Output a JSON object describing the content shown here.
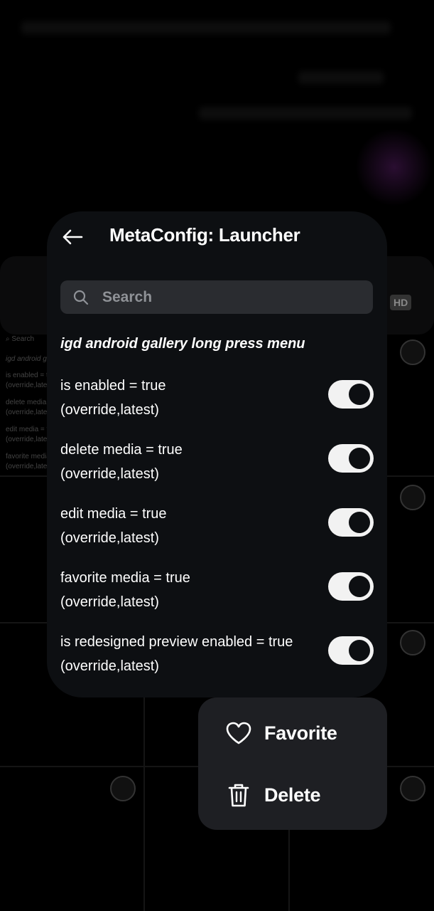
{
  "dialog": {
    "title": "MetaConfig: Launcher",
    "back_icon": "arrow-left-icon",
    "search": {
      "placeholder": "Search",
      "value": ""
    },
    "section_title": "igd android gallery long press menu",
    "configs": [
      {
        "line1": "is enabled = true",
        "line2": "(override,latest)",
        "enabled": true
      },
      {
        "line1": "delete media = true",
        "line2": "(override,latest)",
        "enabled": true
      },
      {
        "line1": "edit media = true",
        "line2": "(override,latest)",
        "enabled": true
      },
      {
        "line1": "favorite media = true",
        "line2": "(override,latest)",
        "enabled": true
      },
      {
        "line1": "is redesigned preview enabled = true",
        "line2": "(override,latest)",
        "enabled": true
      }
    ]
  },
  "context_menu": {
    "items": [
      {
        "label": "Favorite",
        "icon": "heart-icon"
      },
      {
        "label": "Delete",
        "icon": "trash-icon"
      }
    ]
  },
  "background": {
    "badge": "HD",
    "mini_search": "Search",
    "mini_lines": [
      "igd android ga",
      "is enabled = tr",
      "(override,late",
      "delete media =",
      "(override,late",
      "edit media = tr",
      "(override,late",
      "favorite media",
      "(override,late"
    ]
  },
  "colors": {
    "background": "#000000",
    "dialog": "#0d0f12",
    "search_field": "#2a2c30",
    "toggle_on": "#f2f2f2",
    "menu": "#1e1f23"
  }
}
